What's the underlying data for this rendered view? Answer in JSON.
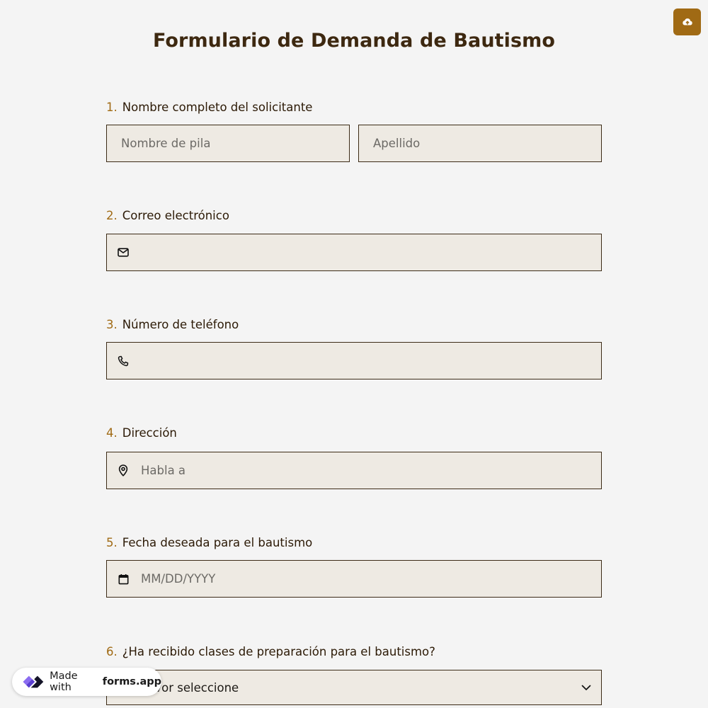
{
  "upload": {
    "icon": "cloud-upload-icon",
    "color": "#a06a14"
  },
  "form": {
    "title": "Formulario de Demanda de Bautismo",
    "questions": [
      {
        "number": "1.",
        "label": "Nombre completo del solicitante",
        "first_name_placeholder": "Nombre de pila",
        "last_name_placeholder": "Apellido"
      },
      {
        "number": "2.",
        "label": "Correo electrónico",
        "icon": "mail-icon",
        "placeholder": ""
      },
      {
        "number": "3.",
        "label": "Número de teléfono",
        "icon": "phone-icon",
        "placeholder": ""
      },
      {
        "number": "4.",
        "label": "Dirección",
        "icon": "map-pin-icon",
        "placeholder": "Habla a"
      },
      {
        "number": "5.",
        "label": "Fecha deseada para el bautismo",
        "icon": "calendar-icon",
        "placeholder": "MM/DD/YYYY"
      },
      {
        "number": "6.",
        "label": "¿Ha recibido clases de preparación para el bautismo?",
        "icon": "chevron-down-icon",
        "select_value": "Por favor seleccione"
      }
    ]
  },
  "badge": {
    "made_with": "Made with",
    "brand": "forms.app"
  },
  "colors": {
    "accent": "#a06a14",
    "field_bg": "#eeeae3",
    "field_border": "#3c2b17",
    "page_bg": "#f4f4f4"
  }
}
